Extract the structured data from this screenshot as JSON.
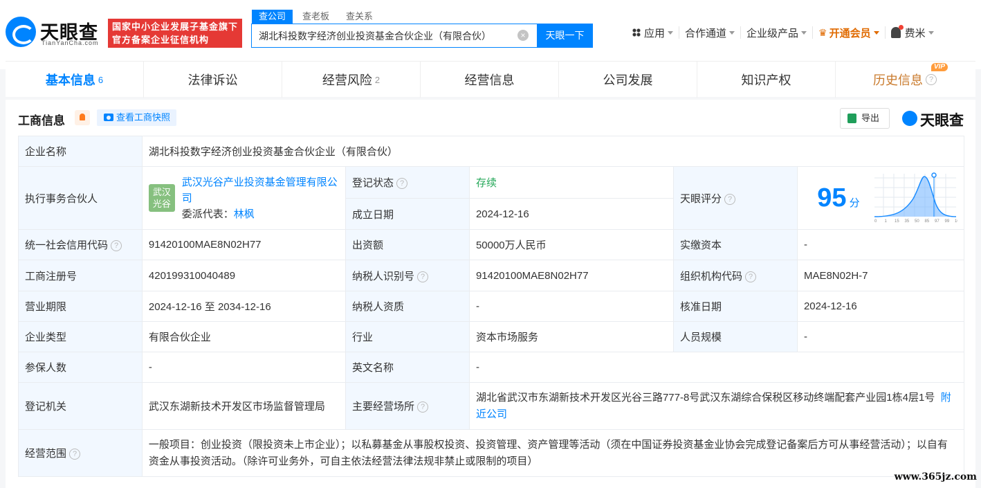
{
  "header": {
    "logo_text": "天眼查",
    "logo_sub": "TianYanCha.com",
    "banner_line1": "国家中小企业发展子基金旗下",
    "banner_line2": "官方备案企业征信机构",
    "search_tabs": [
      "查公司",
      "查老板",
      "查关系"
    ],
    "search_value": "湖北科投数字经济创业投资基金合伙企业（有限合伙）",
    "search_button": "天眼一下",
    "nav": {
      "apps": "应用",
      "channel": "合作通道",
      "enterprise": "企业级产品",
      "vip": "开通会员",
      "user": "费米"
    }
  },
  "tabs": [
    {
      "label": "基本信息",
      "count": "6"
    },
    {
      "label": "法律诉讼",
      "count": ""
    },
    {
      "label": "经营风险",
      "count": "2"
    },
    {
      "label": "经营信息",
      "count": ""
    },
    {
      "label": "公司发展",
      "count": ""
    },
    {
      "label": "知识产权",
      "count": ""
    },
    {
      "label": "历史信息",
      "count": "",
      "badge": "VIP"
    }
  ],
  "panel": {
    "title": "工商信息",
    "snapshot_button": "查看工商快照",
    "export_button": "导出",
    "brand": "天眼查"
  },
  "info": {
    "name_label": "企业名称",
    "name_value": "湖北科投数字经济创业投资基金合伙企业（有限合伙）",
    "partner_label": "执行事务合伙人",
    "partner_logo": "武汉光谷",
    "partner_name": "武汉光谷产业投资基金管理有限公司",
    "delegate_label": "委派代表：",
    "delegate_name": "林枫",
    "status_label": "登记状态",
    "status_value": "存续",
    "founded_label": "成立日期",
    "founded_value": "2024-12-16",
    "score_label": "天眼评分",
    "score_value": "95",
    "score_unit": "分",
    "credit_label": "统一社会信用代码",
    "credit_value": "91420100MAE8N02H77",
    "capital_label": "出资额",
    "capital_value": "50000万人民币",
    "paid_label": "实缴资本",
    "paid_value": "-",
    "reg_label": "工商注册号",
    "reg_value": "420199310040489",
    "tax_label": "纳税人识别号",
    "tax_value": "91420100MAE8N02H77",
    "org_label": "组织机构代码",
    "org_value": "MAE8N02H-7",
    "term_label": "营业期限",
    "term_value": "2024-12-16 至 2034-12-16",
    "taxq_label": "纳税人资质",
    "taxq_value": "-",
    "approve_label": "核准日期",
    "approve_value": "2024-12-16",
    "type_label": "企业类型",
    "type_value": "有限合伙企业",
    "industry_label": "行业",
    "industry_value": "资本市场服务",
    "staff_label": "人员规模",
    "staff_value": "-",
    "insured_label": "参保人数",
    "insured_value": "-",
    "en_label": "英文名称",
    "en_value": "-",
    "authority_label": "登记机关",
    "authority_value": "武汉东湖新技术开发区市场监督管理局",
    "address_label": "主要经营场所",
    "address_value": "湖北省武汉市东湖新技术开发区光谷三路777-8号武汉东湖综合保税区移动终端配套产业园1栋4层1号",
    "nearby_link": "附近公司",
    "scope_label": "经营范围",
    "scope_value": "一般项目：创业投资（限投资未上市企业）；以私募基金从事股权投资、投资管理、资产管理等活动（须在中国证券投资基金业协会完成登记备案后方可从事经营活动）；以自有资金从事投资活动。（除许可业务外，可自主依法经营法律法规非禁止或限制的项目）"
  },
  "score_chart": {
    "x_ticks": [
      "0",
      "1",
      "15",
      "35",
      "50",
      "85",
      "97",
      "99",
      "100"
    ]
  },
  "watermark": "www.365jz.com"
}
